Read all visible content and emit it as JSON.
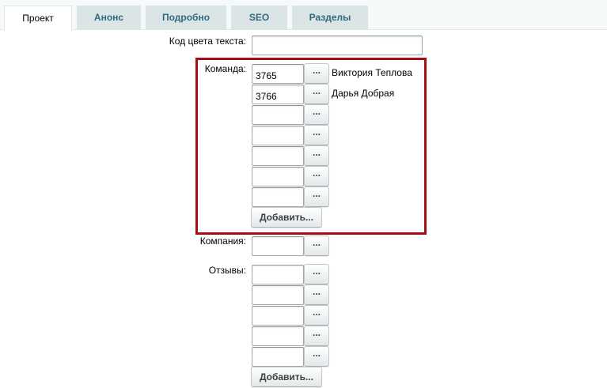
{
  "tabs": [
    {
      "label": "Проект",
      "active": true
    },
    {
      "label": "Анонс",
      "active": false
    },
    {
      "label": "Подробно",
      "active": false
    },
    {
      "label": "SEO",
      "active": false
    },
    {
      "label": "Разделы",
      "active": false
    }
  ],
  "form": {
    "text_color": {
      "label": "Код цвета текста:",
      "value": ""
    },
    "team": {
      "label": "Команда:",
      "rows": [
        {
          "value": "3765",
          "name": "Виктория Теплова"
        },
        {
          "value": "3766",
          "name": "Дарья Добрая"
        },
        {
          "value": "",
          "name": ""
        },
        {
          "value": "",
          "name": ""
        },
        {
          "value": "",
          "name": ""
        },
        {
          "value": "",
          "name": ""
        },
        {
          "value": "",
          "name": ""
        }
      ],
      "add_label": "Добавить..."
    },
    "company": {
      "label": "Компания:",
      "value": ""
    },
    "reviews": {
      "label": "Отзывы:",
      "rows": [
        {
          "value": ""
        },
        {
          "value": ""
        },
        {
          "value": ""
        },
        {
          "value": ""
        },
        {
          "value": ""
        }
      ],
      "add_label": "Добавить..."
    },
    "pick_label": "..."
  },
  "colors": {
    "highlight": "#a80d14",
    "tab_bg": "#dbe5e6",
    "tab_text": "#2f6a80"
  }
}
